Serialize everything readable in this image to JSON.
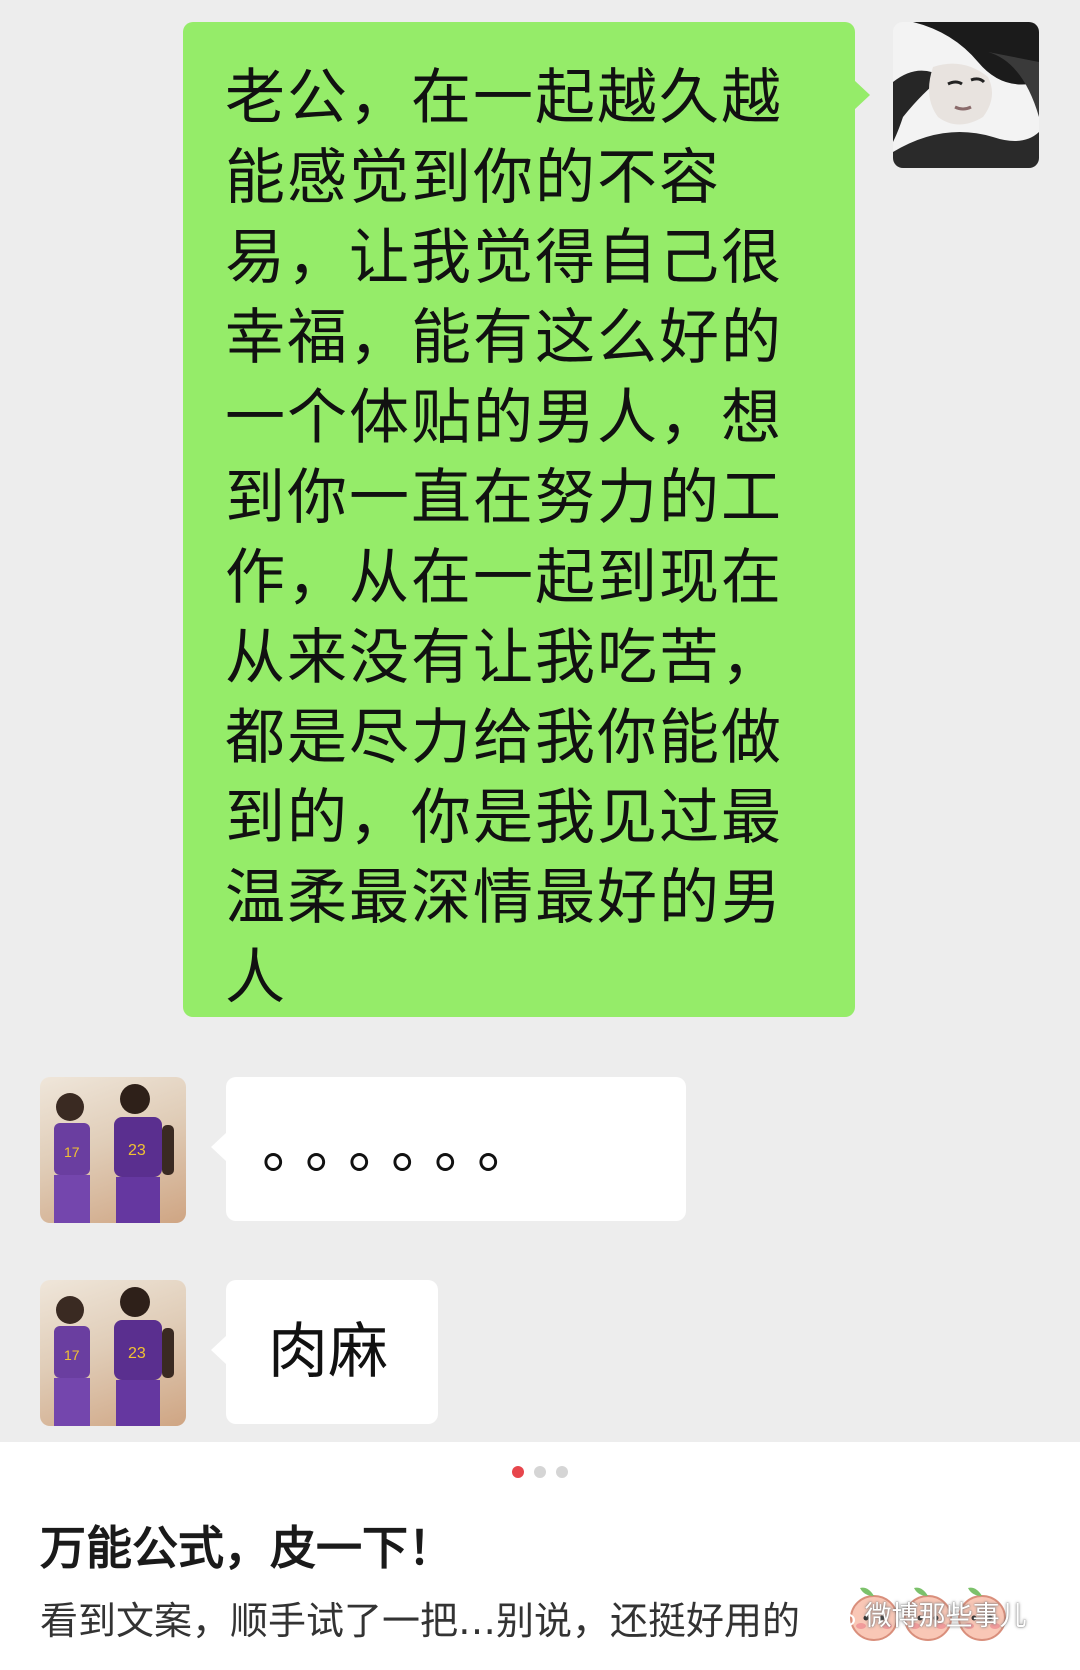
{
  "conversation": {
    "messages": [
      {
        "sender": "self",
        "avatar_icon": "woman-portrait-avatar",
        "text": "老公，在一起越久越能感觉到你的不容易，让我觉得自己很幸福，能有这么好的一个体贴的男人，想到你一直在努力的工作，从在一起到现在从来没有让我吃苦，都是尽力给我你能做到的，你是我见过最温柔最深情最好的男人",
        "lines": [
          "老公，在一起越久越",
          "能感觉到你的不容",
          "易，让我觉得自己很",
          "幸福，能有这么好的",
          "一个体贴的男人，想",
          "到你一直在努力的工",
          "作，从在一起到现在",
          "从来没有让我吃苦，",
          "都是尽力给我你能做",
          "到的，你是我见过最",
          "温柔最深情最好的男",
          "人"
        ]
      },
      {
        "sender": "other",
        "avatar_icon": "basketball-players-avatar",
        "text": "。。。。。。"
      },
      {
        "sender": "other",
        "avatar_icon": "basketball-players-avatar",
        "text": "肉麻"
      }
    ]
  },
  "carousel": {
    "count": 3,
    "active_index": 0
  },
  "post": {
    "title": "万能公式，皮一下！",
    "description": "看到文案，顺手试了一把…别说，还挺好用的"
  },
  "watermark": {
    "text": "微博那些事儿",
    "icon": "wechat-icon"
  },
  "colors": {
    "chat_background": "#ededed",
    "sent_bubble": "#95ec69",
    "received_bubble": "#ffffff",
    "active_dot": "#e7464c",
    "inactive_dot": "#d5d5d5"
  }
}
